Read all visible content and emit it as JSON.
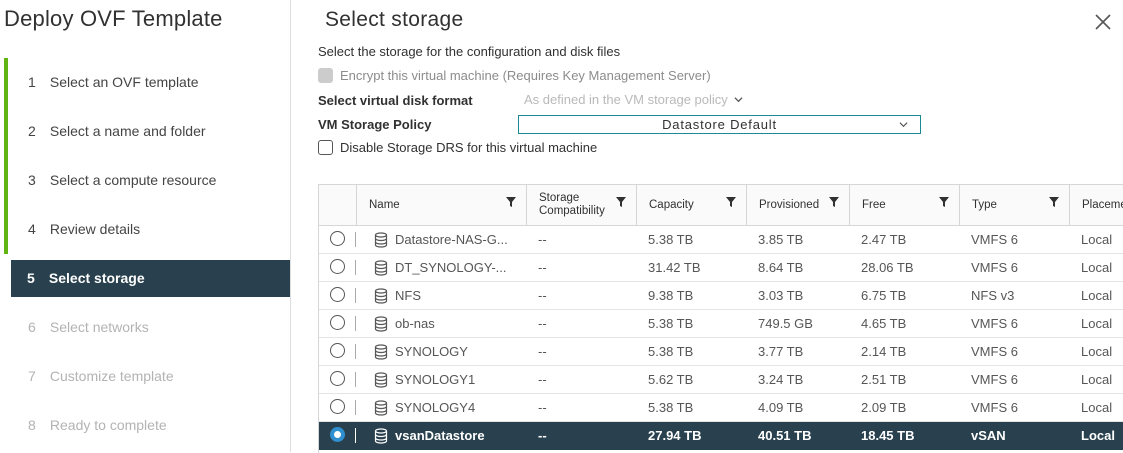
{
  "wizard": {
    "title": "Deploy OVF Template",
    "steps": [
      {
        "num": "1",
        "label": "Select an OVF template"
      },
      {
        "num": "2",
        "label": "Select a name and folder"
      },
      {
        "num": "3",
        "label": "Select a compute resource"
      },
      {
        "num": "4",
        "label": "Review details"
      },
      {
        "num": "5",
        "label": "Select storage"
      },
      {
        "num": "6",
        "label": "Select networks"
      },
      {
        "num": "7",
        "label": "Customize template"
      },
      {
        "num": "8",
        "label": "Ready to complete"
      }
    ]
  },
  "page": {
    "title": "Select storage",
    "description": "Select the storage for the configuration and disk files",
    "encrypt_label": "Encrypt this virtual machine (Requires Key Management Server)",
    "disk_format_label": "Select virtual disk format",
    "disk_format_value": "As defined in the VM storage policy",
    "policy_label": "VM Storage Policy",
    "policy_value": "Datastore Default",
    "drs_label": "Disable Storage DRS for this virtual machine"
  },
  "table": {
    "columns": {
      "name": "Name",
      "compat_line1": "Storage",
      "compat_line2": "Compatibility",
      "capacity": "Capacity",
      "provisioned": "Provisioned",
      "free": "Free",
      "type": "Type",
      "placement": "Placeme"
    },
    "rows": [
      {
        "name": "Datastore-NAS-G...",
        "compat": "--",
        "capacity": "5.38 TB",
        "provisioned": "3.85 TB",
        "free": "2.47 TB",
        "type": "VMFS 6",
        "placement": "Local"
      },
      {
        "name": "DT_SYNOLOGY-...",
        "compat": "--",
        "capacity": "31.42 TB",
        "provisioned": "8.64 TB",
        "free": "28.06 TB",
        "type": "VMFS 6",
        "placement": "Local"
      },
      {
        "name": "NFS",
        "compat": "--",
        "capacity": "9.38 TB",
        "provisioned": "3.03 TB",
        "free": "6.75 TB",
        "type": "NFS v3",
        "placement": "Local"
      },
      {
        "name": "ob-nas",
        "compat": "--",
        "capacity": "5.38 TB",
        "provisioned": "749.5 GB",
        "free": "4.65 TB",
        "type": "VMFS 6",
        "placement": "Local"
      },
      {
        "name": "SYNOLOGY",
        "compat": "--",
        "capacity": "5.38 TB",
        "provisioned": "3.77 TB",
        "free": "2.14 TB",
        "type": "VMFS 6",
        "placement": "Local"
      },
      {
        "name": "SYNOLOGY1",
        "compat": "--",
        "capacity": "5.62 TB",
        "provisioned": "3.24 TB",
        "free": "2.51 TB",
        "type": "VMFS 6",
        "placement": "Local"
      },
      {
        "name": "SYNOLOGY4",
        "compat": "--",
        "capacity": "5.38 TB",
        "provisioned": "4.09 TB",
        "free": "2.09 TB",
        "type": "VMFS 6",
        "placement": "Local"
      },
      {
        "name": "vsanDatastore",
        "compat": "--",
        "capacity": "27.94 TB",
        "provisioned": "40.51 TB",
        "free": "18.45 TB",
        "type": "vSAN",
        "placement": "Local"
      }
    ]
  },
  "colors": {
    "accent": "#29414e",
    "progress_green": "#60b515",
    "select_border": "#1b8a94",
    "radio_selected": "#2f8fcf"
  },
  "icons": [
    "close-icon",
    "filter-icon",
    "datastore-icon",
    "chevron-down-icon"
  ]
}
